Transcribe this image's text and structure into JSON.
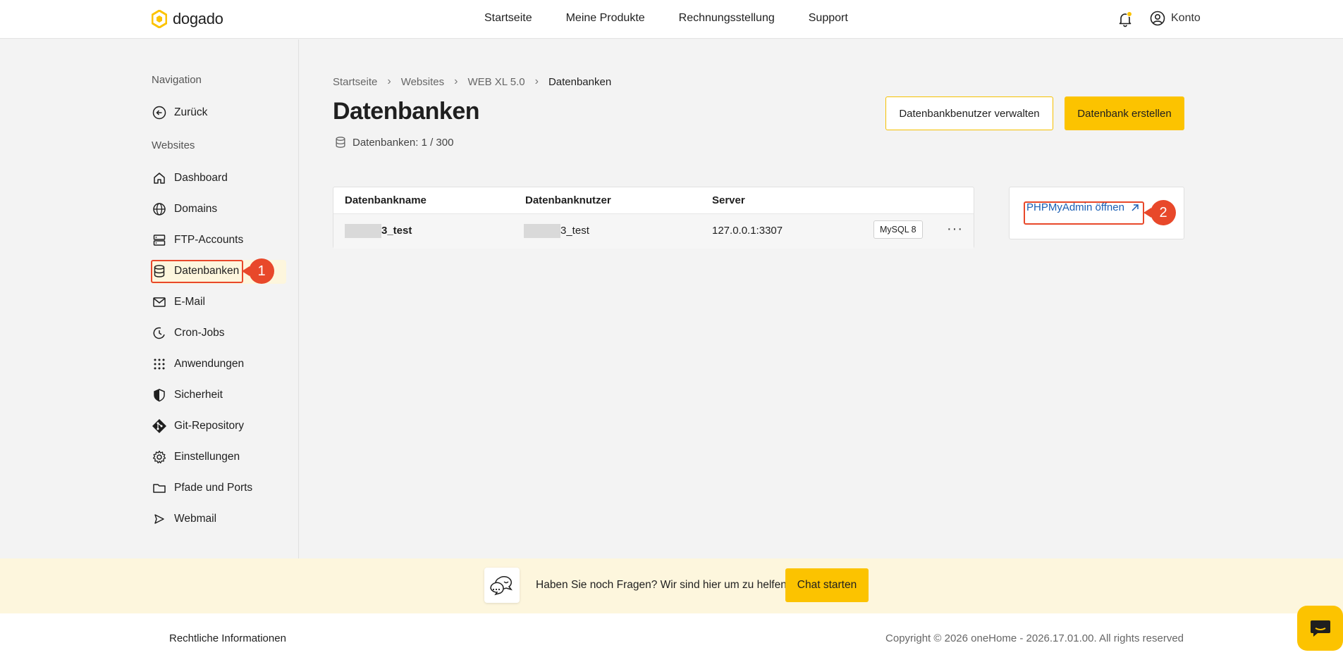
{
  "brand": {
    "name": "dogado",
    "accent": "#fcc300",
    "highlight": "#e8482a"
  },
  "topnav": {
    "items": [
      "Startseite",
      "Meine Produkte",
      "Rechnungsstellung",
      "Support"
    ],
    "account_label": "Konto"
  },
  "sidebar": {
    "heading_navigation": "Navigation",
    "back_label": "Zurück",
    "heading_websites": "Websites",
    "items": [
      {
        "label": "Dashboard",
        "icon": "home-icon"
      },
      {
        "label": "Domains",
        "icon": "globe-icon"
      },
      {
        "label": "FTP-Accounts",
        "icon": "server-icon"
      },
      {
        "label": "Datenbanken",
        "icon": "database-icon"
      },
      {
        "label": "E-Mail",
        "icon": "mail-icon"
      },
      {
        "label": "Cron-Jobs",
        "icon": "clock-icon"
      },
      {
        "label": "Anwendungen",
        "icon": "grid-icon"
      },
      {
        "label": "Sicherheit",
        "icon": "shield-icon"
      },
      {
        "label": "Git-Repository",
        "icon": "git-icon"
      },
      {
        "label": "Einstellungen",
        "icon": "gear-icon"
      },
      {
        "label": "Pfade und Ports",
        "icon": "folder-icon"
      },
      {
        "label": "Webmail",
        "icon": "send-icon"
      }
    ],
    "active_badge": "1"
  },
  "breadcrumb": [
    "Startseite",
    "Websites",
    "WEB XL 5.0",
    "Datenbanken"
  ],
  "page": {
    "title": "Datenbanken",
    "count_text": "Datenbanken: 1 / 300",
    "btn_manage_users": "Datenbankbenutzer verwalten",
    "btn_create": "Datenbank erstellen"
  },
  "table": {
    "columns": [
      "Datenbankname",
      "Datenbanknutzer",
      "Server"
    ],
    "rows": [
      {
        "name_suffix": "3_test",
        "user_suffix": "3_test",
        "server": "127.0.0.1:3307",
        "engine": "MySQL 8"
      }
    ]
  },
  "pma": {
    "link_label": "PHPMyAdmin öffnen",
    "badge": "2"
  },
  "help": {
    "text": "Haben Sie noch Fragen? Wir sind hier um zu helfen.",
    "button": "Chat starten"
  },
  "footer": {
    "legal": "Rechtliche Informationen",
    "copyright": "Copyright © 2026 oneHome - 2026.17.01.00. All rights reserved"
  }
}
